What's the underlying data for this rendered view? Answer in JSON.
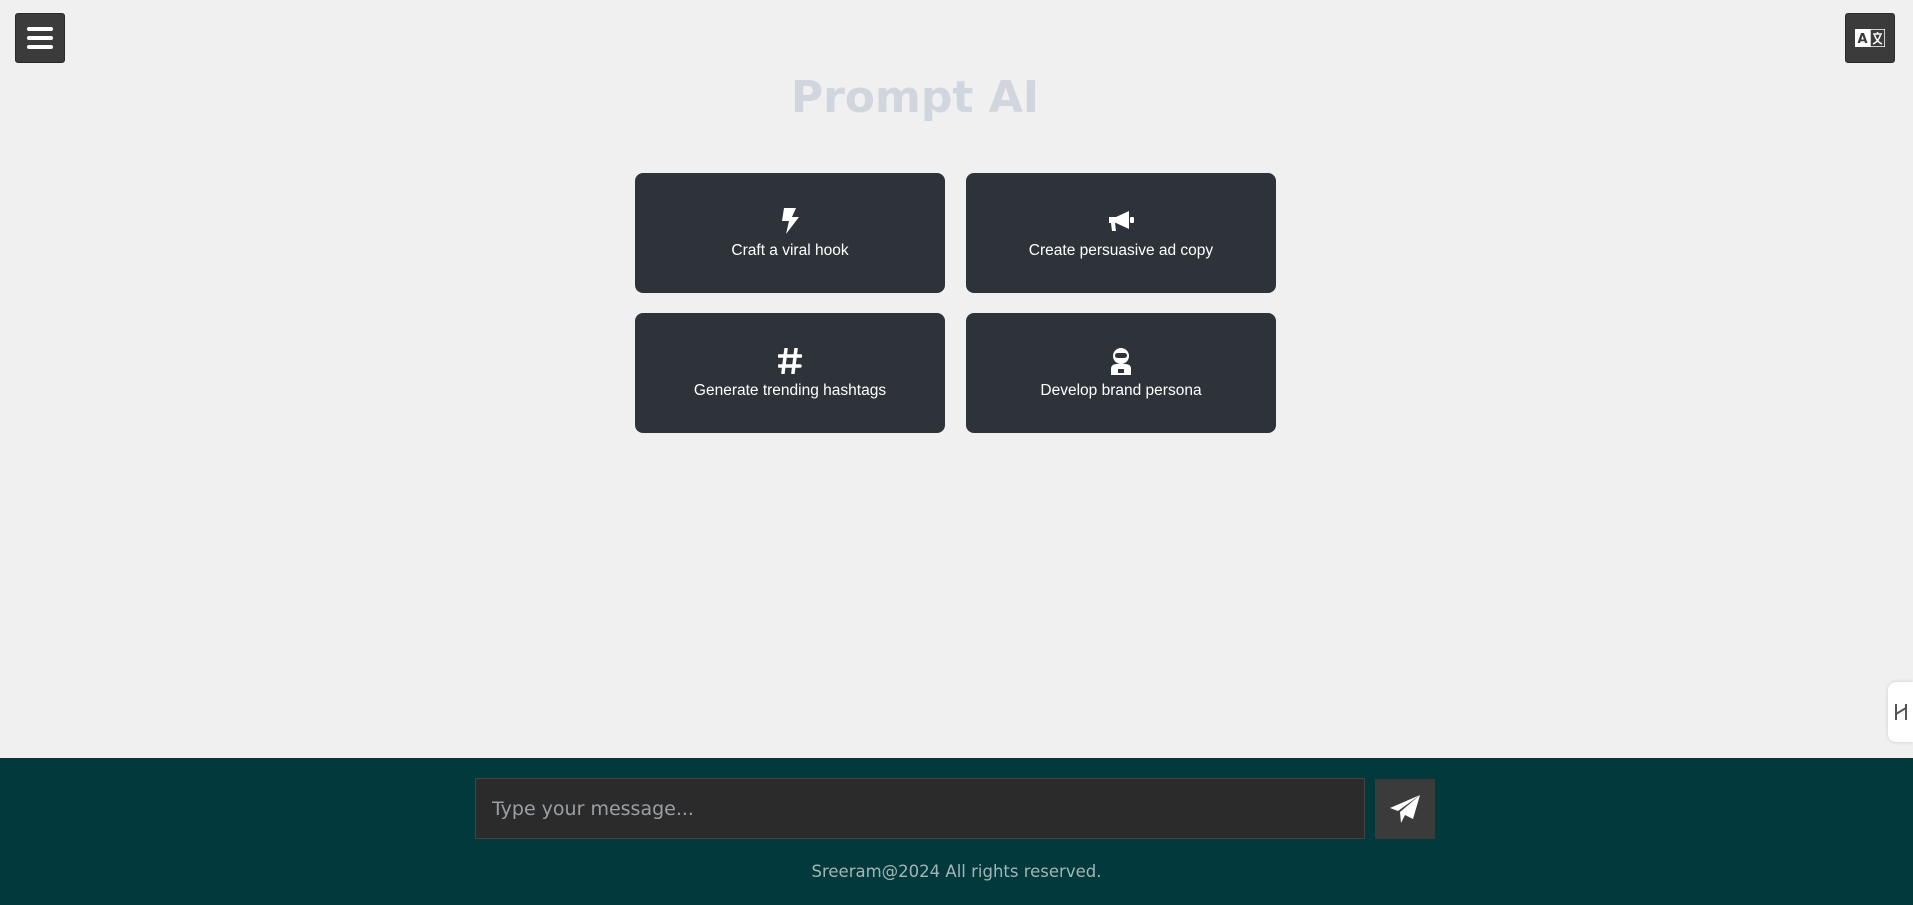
{
  "header": {
    "title": "Prompt AI",
    "menu_icon": "hamburger-icon",
    "language_icon": "translate-icon"
  },
  "cards": [
    {
      "icon": "bolt-icon",
      "label": "Craft a viral hook"
    },
    {
      "icon": "megaphone-icon",
      "label": "Create persuasive ad copy"
    },
    {
      "icon": "hashtag-icon",
      "label": "Generate trending hashtags"
    },
    {
      "icon": "astronaut-icon",
      "label": "Develop brand persona"
    }
  ],
  "footer": {
    "input_placeholder": "Type your message...",
    "input_value": "",
    "send_icon": "paper-plane-icon",
    "copyright": "Sreeram@2024 All rights reserved."
  },
  "colors": {
    "background": "#f0f0f0",
    "card_bg": "#2d3339",
    "footer_bg": "#02393c",
    "title": "#d1d6de"
  }
}
